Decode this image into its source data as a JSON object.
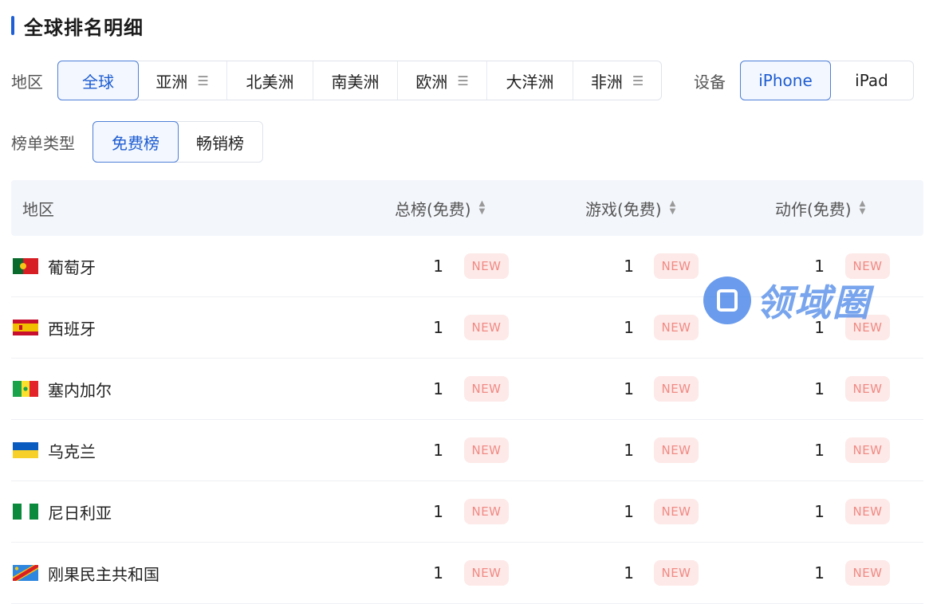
{
  "title": "全球排名明细",
  "region_filter": {
    "label": "地区",
    "options": [
      {
        "label": "全球",
        "menu": false,
        "active": true
      },
      {
        "label": "亚洲",
        "menu": true,
        "active": false
      },
      {
        "label": "北美洲",
        "menu": false,
        "active": false
      },
      {
        "label": "南美洲",
        "menu": false,
        "active": false
      },
      {
        "label": "欧洲",
        "menu": true,
        "active": false
      },
      {
        "label": "大洋洲",
        "menu": false,
        "active": false
      },
      {
        "label": "非洲",
        "menu": true,
        "active": false
      }
    ],
    "menu_glyph": "☰"
  },
  "device_filter": {
    "label": "设备",
    "options": [
      {
        "label": "iPhone",
        "active": true
      },
      {
        "label": "iPad",
        "active": false
      }
    ]
  },
  "chart_type_filter": {
    "label": "榜单类型",
    "options": [
      {
        "label": "免费榜",
        "active": true
      },
      {
        "label": "畅销榜",
        "active": false
      }
    ]
  },
  "table": {
    "headers": {
      "region": "地区",
      "overall": "总榜(免费)",
      "games": "游戏(免费)",
      "action": "动作(免费)"
    },
    "sort_up": "▲",
    "sort_down": "▼",
    "rows": [
      {
        "region": "葡萄牙",
        "flag": "portugal",
        "overall": "1",
        "games": "1",
        "action": "1",
        "badge": "NEW"
      },
      {
        "region": "西班牙",
        "flag": "spain",
        "overall": "1",
        "games": "1",
        "action": "1",
        "badge": "NEW"
      },
      {
        "region": "塞内加尔",
        "flag": "senegal",
        "overall": "1",
        "games": "1",
        "action": "1",
        "badge": "NEW"
      },
      {
        "region": "乌克兰",
        "flag": "ukraine",
        "overall": "1",
        "games": "1",
        "action": "1",
        "badge": "NEW"
      },
      {
        "region": "尼日利亚",
        "flag": "nigeria",
        "overall": "1",
        "games": "1",
        "action": "1",
        "badge": "NEW"
      },
      {
        "region": "刚果民主共和国",
        "flag": "drc",
        "overall": "1",
        "games": "1",
        "action": "1",
        "badge": "NEW"
      }
    ]
  },
  "watermark": {
    "text": "领域圈"
  },
  "colors": {
    "accent": "#1e5dd0",
    "badge_bg": "#fde9e8",
    "badge_text": "#f08a84",
    "header_bg": "#f3f6fb"
  }
}
